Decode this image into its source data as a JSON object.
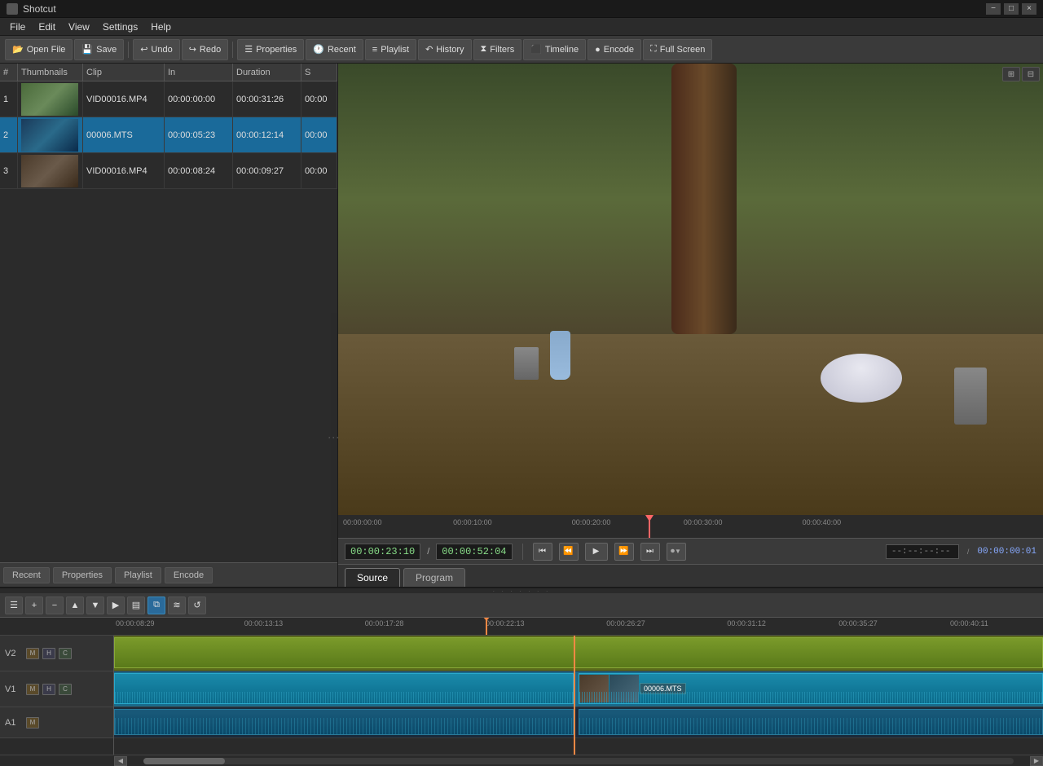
{
  "app": {
    "title": "Shotcut",
    "icon": "film-icon"
  },
  "titlebar": {
    "title": "Shotcut",
    "minimize_label": "−",
    "restore_label": "□",
    "close_label": "×"
  },
  "menubar": {
    "items": [
      "File",
      "Edit",
      "View",
      "Settings",
      "Help"
    ]
  },
  "toolbar": {
    "buttons": [
      {
        "id": "open-file",
        "label": "Open File",
        "icon": "folder-open-icon"
      },
      {
        "id": "save",
        "label": "Save",
        "icon": "save-icon"
      },
      {
        "id": "undo",
        "label": "Undo",
        "icon": "undo-icon"
      },
      {
        "id": "redo",
        "label": "Redo",
        "icon": "redo-icon"
      },
      {
        "id": "properties",
        "label": "Properties",
        "icon": "properties-icon"
      },
      {
        "id": "recent",
        "label": "Recent",
        "icon": "recent-icon"
      },
      {
        "id": "playlist",
        "label": "Playlist",
        "icon": "playlist-icon"
      },
      {
        "id": "history",
        "label": "History",
        "icon": "history-icon"
      },
      {
        "id": "filters",
        "label": "Filters",
        "icon": "filters-icon"
      },
      {
        "id": "timeline",
        "label": "Timeline",
        "icon": "timeline-icon"
      },
      {
        "id": "encode",
        "label": "Encode",
        "icon": "encode-icon"
      },
      {
        "id": "fullscreen",
        "label": "Full Screen",
        "icon": "fullscreen-icon"
      }
    ]
  },
  "playlist": {
    "columns": [
      "#",
      "Thumbnails",
      "Clip",
      "In",
      "Duration",
      "S"
    ],
    "rows": [
      {
        "num": "1",
        "clip": "VID00016.MP4",
        "in": "00:00:00:00",
        "duration": "00:00:31:26",
        "sp": "00:00",
        "thumb_class": "thumb-1",
        "selected": false
      },
      {
        "num": "2",
        "clip": "00006.MTS",
        "in": "00:00:05:23",
        "duration": "00:00:12:14",
        "sp": "00:00",
        "thumb_class": "thumb-2",
        "selected": true
      },
      {
        "num": "3",
        "clip": "VID00016.MP4",
        "in": "00:00:08:24",
        "duration": "00:00:09:27",
        "sp": "00:00",
        "thumb_class": "thumb-3",
        "selected": false
      }
    ]
  },
  "panel_tabs": [
    "Recent",
    "Properties",
    "Playlist",
    "Encode"
  ],
  "preview": {
    "timecode_current": "00:00:23:10",
    "timecode_total": "00:00:52:04",
    "in_out": "--:--:--:--",
    "total_time": "00:00:00:01",
    "ruler_marks": [
      "00:00:00:00",
      "00:00:10:00",
      "00:00:20:00",
      "00:00:30:00",
      "00:00:40:00"
    ]
  },
  "view_tabs": [
    {
      "id": "source",
      "label": "Source",
      "active": true
    },
    {
      "id": "program",
      "label": "Program",
      "active": false
    }
  ],
  "timeline": {
    "toolbar_buttons": [
      {
        "id": "tl-menu",
        "label": "☰",
        "icon": "hamburger-icon"
      },
      {
        "id": "tl-add",
        "label": "+",
        "icon": "add-track-icon"
      },
      {
        "id": "tl-remove",
        "label": "−",
        "icon": "remove-track-icon"
      },
      {
        "id": "tl-up",
        "label": "▲",
        "icon": "move-up-icon"
      },
      {
        "id": "tl-down",
        "label": "▼",
        "icon": "move-down-icon"
      },
      {
        "id": "tl-right",
        "label": "▶",
        "icon": "ripple-icon"
      },
      {
        "id": "tl-scrub",
        "label": "⬛",
        "icon": "scrub-icon"
      },
      {
        "id": "tl-snap",
        "label": "⧉",
        "icon": "snap-icon",
        "active": true
      },
      {
        "id": "tl-ripple-all",
        "label": "≋",
        "icon": "ripple-all-icon"
      },
      {
        "id": "tl-loop",
        "label": "↺",
        "icon": "loop-icon"
      }
    ],
    "ruler_marks": [
      "00:00:08:29",
      "00:00:13:13",
      "00:00:17:28",
      "00:00:22:13",
      "00:00:26:27",
      "00:00:31:12",
      "00:00:35:27",
      "00:00:40:11"
    ],
    "tracks": [
      {
        "id": "V2",
        "name": "V2",
        "buttons": [
          "M",
          "H",
          "C"
        ],
        "color": "green"
      },
      {
        "id": "V1",
        "name": "V1",
        "buttons": [
          "M",
          "H",
          "C"
        ],
        "color": "teal"
      },
      {
        "id": "A1",
        "name": "A1",
        "buttons": [
          "M"
        ],
        "color": "dark-teal"
      }
    ],
    "clip_v1_right": {
      "label": "00006.MTS"
    }
  }
}
